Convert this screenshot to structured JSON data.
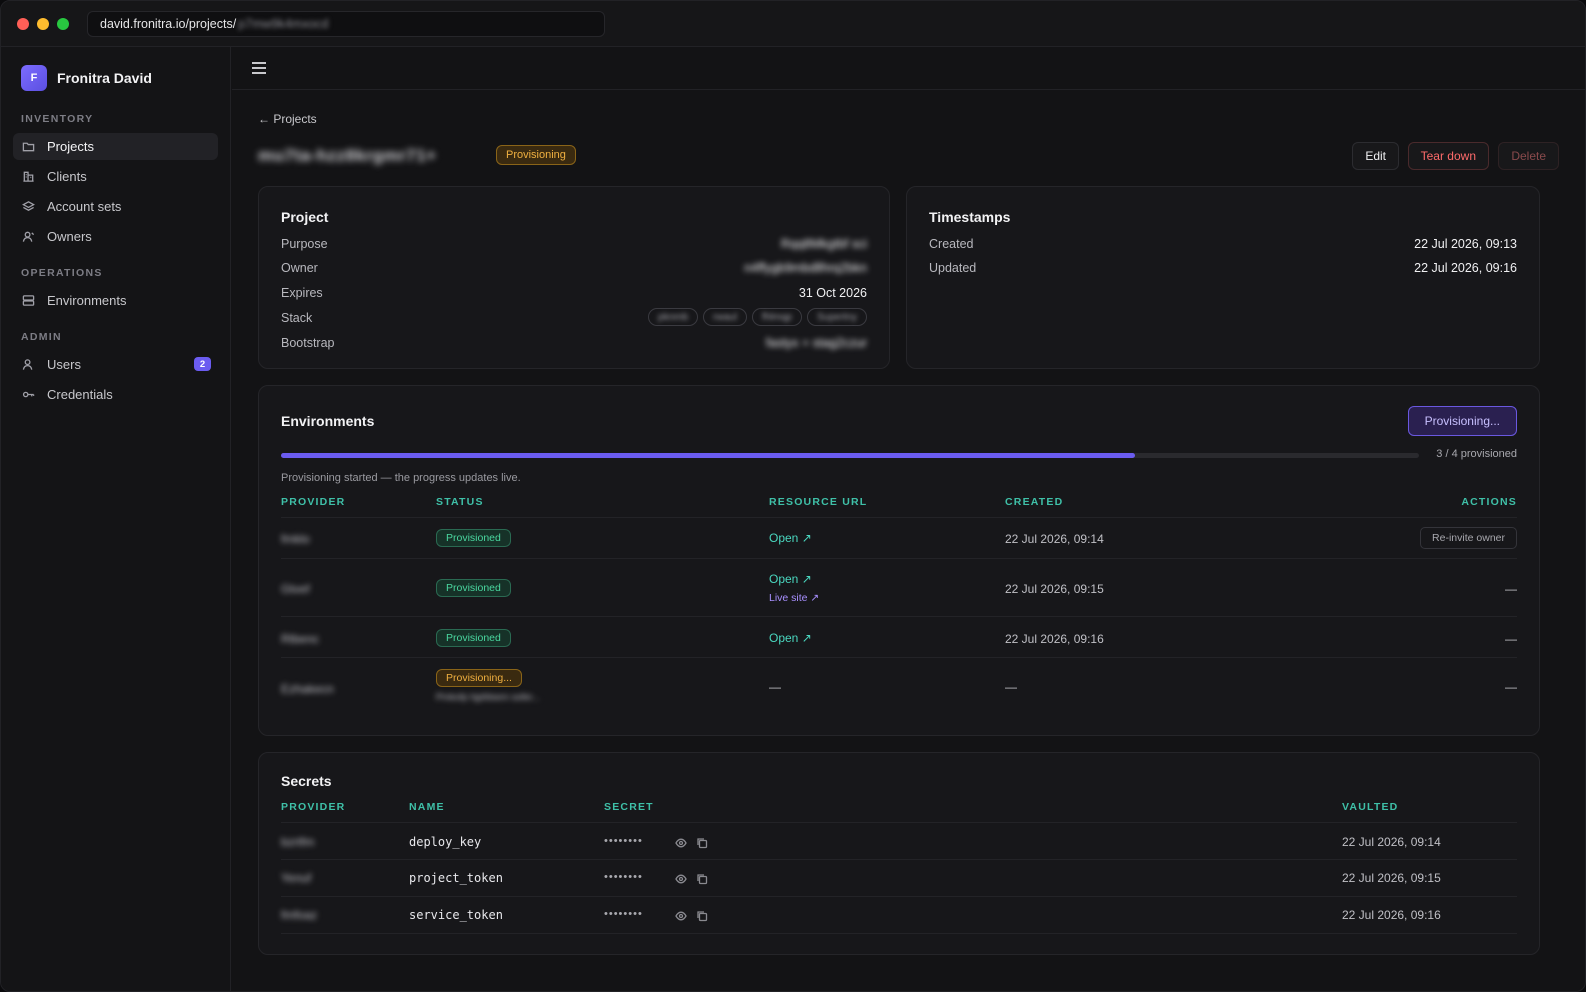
{
  "browser": {
    "url_prefix": "david.fronitra.io/projects/",
    "url_tail": "p7mw9k4mxocd"
  },
  "sidebar": {
    "brand_logo": "F",
    "brand_name": "Fronitra David",
    "sections": [
      {
        "title": "INVENTORY",
        "items": [
          {
            "label": "Projects",
            "icon": "folder-icon",
            "active": true
          },
          {
            "label": "Clients",
            "icon": "building-icon"
          },
          {
            "label": "Account sets",
            "icon": "layers-icon"
          },
          {
            "label": "Owners",
            "icon": "owner-icon"
          }
        ]
      },
      {
        "title": "OPERATIONS",
        "items": [
          {
            "label": "Environments",
            "icon": "server-icon"
          }
        ]
      },
      {
        "title": "ADMIN",
        "items": [
          {
            "label": "Users",
            "icon": "user-icon",
            "badge": "2"
          },
          {
            "label": "Credentials",
            "icon": "key-icon"
          }
        ]
      }
    ]
  },
  "main": {
    "breadcrumb": "← Projects",
    "project_name": "mu7ta-hzz8krgmr71+",
    "status": "Provisioning",
    "actions": {
      "edit": "Edit",
      "teardown": "Tear down",
      "delete": "Delete"
    },
    "project_card": {
      "title": "Project",
      "purpose_label": "Purpose",
      "purpose_value": "Rqq8Mkgtbf sci",
      "owner_label": "Owner",
      "owner_value": "n4ffygb9mbdllhrq2bkn",
      "expires_label": "Expires",
      "expires_value": "31 Oct 2026",
      "stack_label": "Stack",
      "stack_chips": [
        "pknmb",
        "rwaul",
        "fhlmqp",
        "Supertny"
      ],
      "bootstrap_label": "Bootstrap",
      "bootstrap_value": "fastyx + stag2czur"
    },
    "timestamps_card": {
      "title": "Timestamps",
      "created_label": "Created",
      "created_value": "22 Jul 2026, 09:13",
      "updated_label": "Updated",
      "updated_value": "22 Jul 2026, 09:16"
    },
    "environments": {
      "title": "Environments",
      "button": "Provisioning...",
      "progress_fraction": 0.75,
      "progress_label": "3 / 4 provisioned",
      "note": "Provisioning started — the progress updates live.",
      "headers": [
        "PROVIDER",
        "STATUS",
        "RESOURCE URL",
        "CREATED",
        "ACTIONS"
      ],
      "rows": [
        {
          "provider": "fmklo",
          "status": "Provisioned",
          "open": "Open ↗",
          "live": "",
          "created": "22 Jul 2026, 09:14",
          "action": "Re-invite owner"
        },
        {
          "provider": "Gtvef",
          "status": "Provisioned",
          "open": "Open ↗",
          "live": "Live site ↗",
          "created": "22 Jul 2026, 09:15",
          "action": "—"
        },
        {
          "provider": "Rtbenc",
          "status": "Provisioned",
          "open": "Open ↗",
          "live": "",
          "created": "22 Jul 2026, 09:16",
          "action": "—"
        },
        {
          "provider": "Ezhakecn",
          "status": "Provisioning...",
          "open": "—",
          "live": "",
          "created": "—",
          "action": "—",
          "substatus": "Pmkxfp hjpfdsem sofer..."
        }
      ]
    },
    "secrets": {
      "title": "Secrets",
      "headers": [
        "PROVIDER",
        "NAME",
        "SECRET",
        "VAULTED"
      ],
      "rows": [
        {
          "provider": "bzrtfm",
          "name": "deploy_key",
          "secret": "••••••••",
          "vaulted": "22 Jul 2026, 09:14"
        },
        {
          "provider": "Yenuf",
          "name": "project_token",
          "secret": "••••••••",
          "vaulted": "22 Jul 2026, 09:15"
        },
        {
          "provider": "fmfoaz",
          "name": "service_token",
          "secret": "••••••••",
          "vaulted": "22 Jul 2026, 09:16"
        }
      ]
    }
  }
}
